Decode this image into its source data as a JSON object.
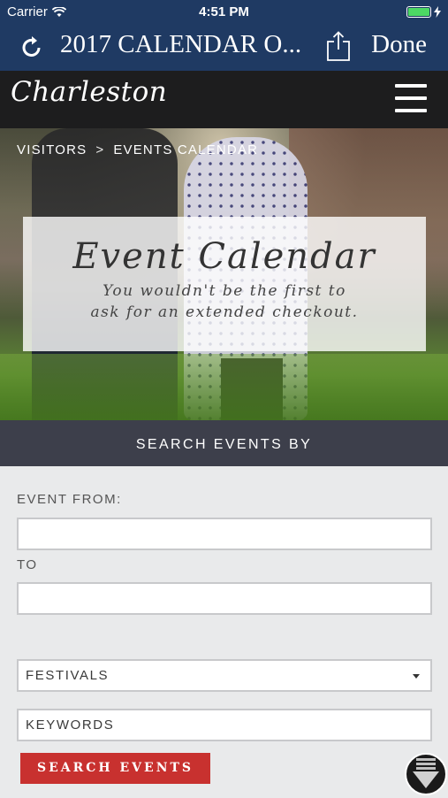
{
  "status_bar": {
    "carrier": "Carrier",
    "time": "4:51 PM",
    "battery_level": 1.0
  },
  "nav": {
    "title": "2017 CALENDAR O...",
    "done_label": "Done"
  },
  "site": {
    "logo": "Charleston"
  },
  "breadcrumb": {
    "items": [
      "VISITORS",
      "EVENTS CALENDAR"
    ],
    "separator": ">"
  },
  "hero": {
    "title": "Event Calendar",
    "subtitle_line1": "You wouldn't be the first to",
    "subtitle_line2": "ask for an extended checkout."
  },
  "search": {
    "band_label": "SEARCH EVENTS BY",
    "from_label": "EVENT FROM:",
    "from_value": "",
    "to_label": "TO",
    "to_value": "",
    "category_selected": "FESTIVALS",
    "keywords_placeholder": "KEYWORDS",
    "button_label": "SEARCH EVENTS"
  },
  "colors": {
    "nav": "#1f3a63",
    "header": "#1d1d1e",
    "band": "#3d3f4b",
    "button": "#c8312f",
    "form_bg": "#e9eaeb"
  }
}
